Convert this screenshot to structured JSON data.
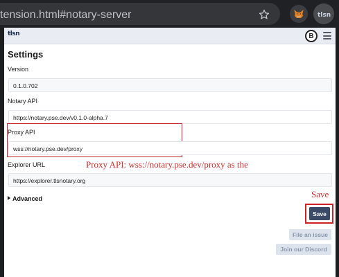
{
  "browser": {
    "url_fragment": "tension.html#notary-server",
    "extensions": [
      {
        "name": "fox-extension-icon"
      },
      {
        "name": "tlsn-extension-icon",
        "label": "tlsn"
      }
    ]
  },
  "popup": {
    "logo_text": "tlsn",
    "avatar_text": "B",
    "title": "Settings",
    "fields": {
      "version": {
        "label": "Version",
        "value": "0.1.0.702"
      },
      "notary_api": {
        "label": "Notary API",
        "value": "https://notary.pse.dev/v0.1.0-alpha.7"
      },
      "proxy_api": {
        "label": "Proxy API",
        "value": "wss://notary.pse.dev/proxy"
      },
      "explorer_url": {
        "label": "Explorer URL",
        "value": "https://explorer.tlsnotary.org"
      }
    },
    "advanced_label": "Advanced",
    "save_label": "Save",
    "file_issue_label": "File an issue",
    "discord_label": "Join our Discord"
  },
  "annotations": {
    "proxy_note": "Proxy API: wss://notary.pse.dev/proxy as the",
    "save_note": "Save",
    "color": "#d62b2b"
  }
}
